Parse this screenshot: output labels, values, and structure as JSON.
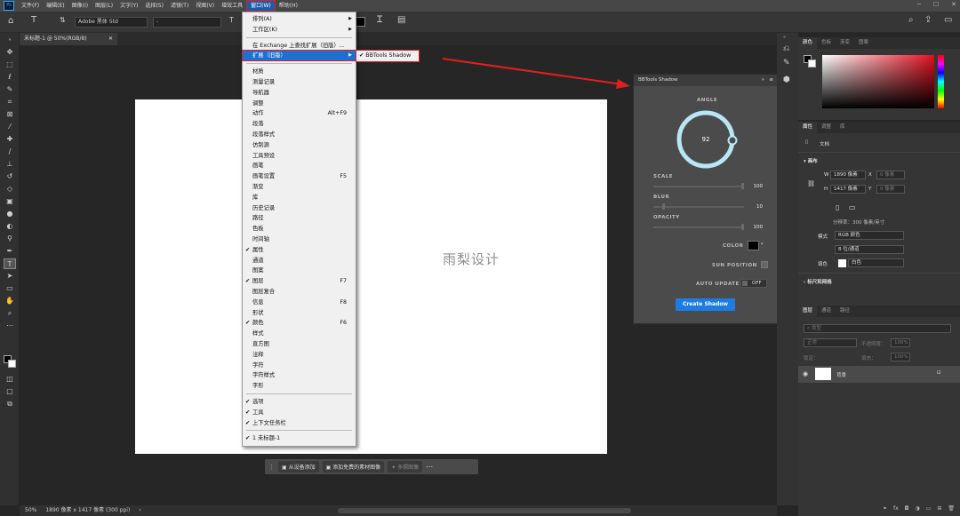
{
  "menubar": {
    "items": [
      "文件(F)",
      "编辑(E)",
      "图像(I)",
      "图层(L)",
      "文字(Y)",
      "选择(S)",
      "滤镜(T)",
      "视图(V)",
      "增效工具",
      "窗口(W)",
      "帮助(H)"
    ],
    "active_index": 9
  },
  "options": {
    "font_family": "Adobe 黑体 Std",
    "font_style": "-",
    "font_size_placeholder": "",
    "tool_letter": "T"
  },
  "document": {
    "tab_title": "未标题-1 @ 50%(RGB/8)",
    "zoom": "50%",
    "status": "1890 像素 x 1417 像素 (300 ppi)",
    "watermark": "雨梨设计"
  },
  "context_bar": {
    "btn1": "从设备添加",
    "btn2": "添加免费的素材图像",
    "btn3": "多照图像"
  },
  "window_menu": {
    "items": [
      {
        "label": "排列(A)",
        "arrow": true
      },
      {
        "label": "工作区(K)",
        "arrow": true
      },
      {
        "sep": true
      },
      {
        "label": "在 Exchange 上查找扩展（旧版）..."
      },
      {
        "label": "扩展（旧版）",
        "arrow": true,
        "highlight": true
      },
      {
        "sep": true
      },
      {
        "label": "材质"
      },
      {
        "label": "测量记录"
      },
      {
        "label": "导航器"
      },
      {
        "label": "调整"
      },
      {
        "label": "动作",
        "shortcut": "Alt+F9"
      },
      {
        "label": "段落"
      },
      {
        "label": "段落样式"
      },
      {
        "label": "仿制源"
      },
      {
        "label": "工具预设"
      },
      {
        "label": "画笔"
      },
      {
        "label": "画笔设置",
        "shortcut": "F5"
      },
      {
        "label": "渐变"
      },
      {
        "label": "库"
      },
      {
        "label": "历史记录"
      },
      {
        "label": "路径"
      },
      {
        "label": "色板"
      },
      {
        "label": "时间轴"
      },
      {
        "label": "属性",
        "checked": true
      },
      {
        "label": "通道"
      },
      {
        "label": "图案"
      },
      {
        "label": "图层",
        "checked": true,
        "shortcut": "F7"
      },
      {
        "label": "图层复合"
      },
      {
        "label": "信息",
        "shortcut": "F8"
      },
      {
        "label": "形状"
      },
      {
        "label": "颜色",
        "checked": true,
        "shortcut": "F6"
      },
      {
        "label": "样式"
      },
      {
        "label": "直方图"
      },
      {
        "label": "注释"
      },
      {
        "label": "字符"
      },
      {
        "label": "字符样式"
      },
      {
        "label": "字形"
      },
      {
        "sep": true
      },
      {
        "label": "选项",
        "checked": true
      },
      {
        "label": "工具",
        "checked": true
      },
      {
        "label": "上下文任务栏",
        "checked": true
      },
      {
        "sep": true
      },
      {
        "label": "1 未标题-1",
        "checked": true
      }
    ]
  },
  "submenu": {
    "label": "BBTools Shadow",
    "checked": true
  },
  "bbtools": {
    "title": "BBTools Shadow",
    "angle_label": "ANGLE",
    "angle_value": "92",
    "scale_label": "SCALE",
    "scale_value": "100",
    "scale_level": 1.0,
    "blur_label": "BLUR",
    "blur_value": "10",
    "blur_level": 0.1,
    "opacity_label": "OPACITY",
    "opacity_value": "100",
    "opacity_level": 1.0,
    "color_label": "COLOR",
    "sun_label": "SUN POSITION",
    "auto_label": "AUTO UPDATE",
    "auto_value": "OFF",
    "create_label": "Create Shadow",
    "ring_color": "#b8e6f5"
  },
  "color_panel": {
    "tabs": [
      "颜色",
      "色板",
      "渐变",
      "图案"
    ]
  },
  "properties_panel": {
    "tabs": [
      "属性",
      "调整",
      "库"
    ],
    "doc_label": "文档",
    "canvas_label": "画布",
    "w_label": "W",
    "w_value": "1890 像素",
    "x_label": "X",
    "x_value": "0 像素",
    "h_label": "H",
    "h_value": "1417 像素",
    "y_label": "Y",
    "y_value": "0 像素",
    "resolution": "分辨率：300 像素/英寸",
    "mode_label": "模式",
    "mode_value": "RGB 颜色",
    "depth_value": "8 位/通道",
    "fill_label": "填色",
    "fill_value": "白色",
    "rulers_label": "标尺和网格"
  },
  "layers_panel": {
    "tabs": [
      "图层",
      "通道",
      "路径"
    ],
    "search_placeholder": "类型",
    "blend_mode": "正常",
    "opacity_label": "不透明度：",
    "opacity_value": "100%",
    "lock_label": "锁定：",
    "fill_label": "填充：",
    "fill_value": "100%",
    "layer_name": "背景"
  }
}
